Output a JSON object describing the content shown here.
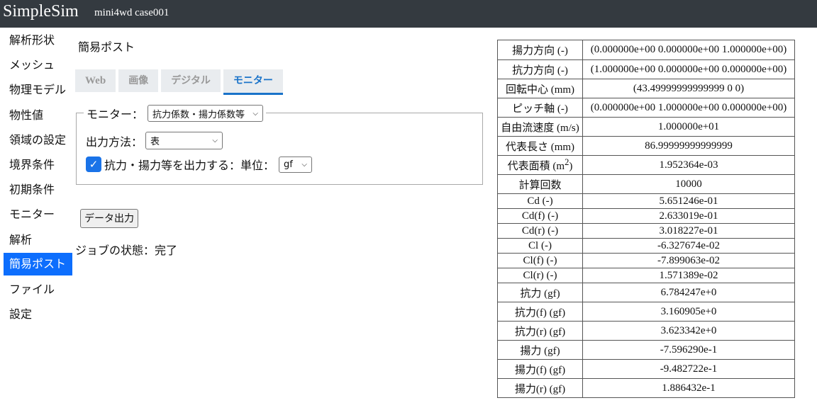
{
  "header": {
    "app_title": "SimpleSim",
    "case_name": "mini4wd case001"
  },
  "sidebar": {
    "items": [
      {
        "label": "解析形状"
      },
      {
        "label": "メッシュ"
      },
      {
        "label": "物理モデル"
      },
      {
        "label": "物性値"
      },
      {
        "label": "領域の設定"
      },
      {
        "label": "境界条件"
      },
      {
        "label": "初期条件"
      },
      {
        "label": "モニター"
      },
      {
        "label": "解析"
      },
      {
        "label": "簡易ポスト",
        "active": true
      },
      {
        "label": "ファイル"
      },
      {
        "label": "設定"
      }
    ]
  },
  "main": {
    "title": "簡易ポスト",
    "tabs": [
      {
        "label": "Web"
      },
      {
        "label": "画像"
      },
      {
        "label": "デジタル"
      },
      {
        "label": "モニター",
        "active": true
      }
    ],
    "monitor": {
      "legend_label": "モニター：",
      "monitor_select": "抗力係数・揚力係数等",
      "output_method_label": "出力方法：",
      "output_method_select": "表",
      "checkbox_checked": true,
      "checkbox_label": "抗力・揚力等を出力する：単位：",
      "unit_select": "gf"
    },
    "export_button": "データ出力",
    "job_status": "ジョブの状態：完了"
  },
  "results": {
    "rows": [
      {
        "label": "揚力方向 (-)",
        "value": "(0.000000e+00 0.000000e+00 1.000000e+00)"
      },
      {
        "label": "抗力方向 (-)",
        "value": "(1.000000e+00 0.000000e+00 0.000000e+00)"
      },
      {
        "label": "回転中心 (mm)",
        "value": "(43.49999999999999 0 0)"
      },
      {
        "label": "ピッチ軸 (-)",
        "value": "(0.000000e+00 1.000000e+00 0.000000e+00)"
      },
      {
        "label": "自由流速度 (m/s)",
        "value": "1.000000e+01"
      },
      {
        "label": "代表長さ (mm)",
        "value": "86.99999999999999"
      },
      {
        "label": "代表面積 (m",
        "label_sup": "2",
        "label_end": ")",
        "value": "1.952364e-03"
      },
      {
        "label": "計算回数",
        "value": "10000"
      },
      {
        "label": "Cd (-)",
        "value": "5.651246e-01"
      },
      {
        "label": "Cd(f) (-)",
        "value": "2.633019e-01"
      },
      {
        "label": "Cd(r) (-)",
        "value": "3.018227e-01"
      },
      {
        "label": "Cl (-)",
        "value": "-6.327674e-02"
      },
      {
        "label": "Cl(f) (-)",
        "value": "-7.899063e-02"
      },
      {
        "label": "Cl(r) (-)",
        "value": "1.571389e-02"
      },
      {
        "label": "抗力 (gf)",
        "value": "6.784247e+0"
      },
      {
        "label": "抗力(f) (gf)",
        "value": "3.160905e+0"
      },
      {
        "label": "抗力(r) (gf)",
        "value": "3.623342e+0"
      },
      {
        "label": "揚力 (gf)",
        "value": "-7.596290e-1"
      },
      {
        "label": "揚力(f) (gf)",
        "value": "-9.482722e-1"
      },
      {
        "label": "揚力(r) (gf)",
        "value": "1.886432e-1"
      }
    ]
  }
}
